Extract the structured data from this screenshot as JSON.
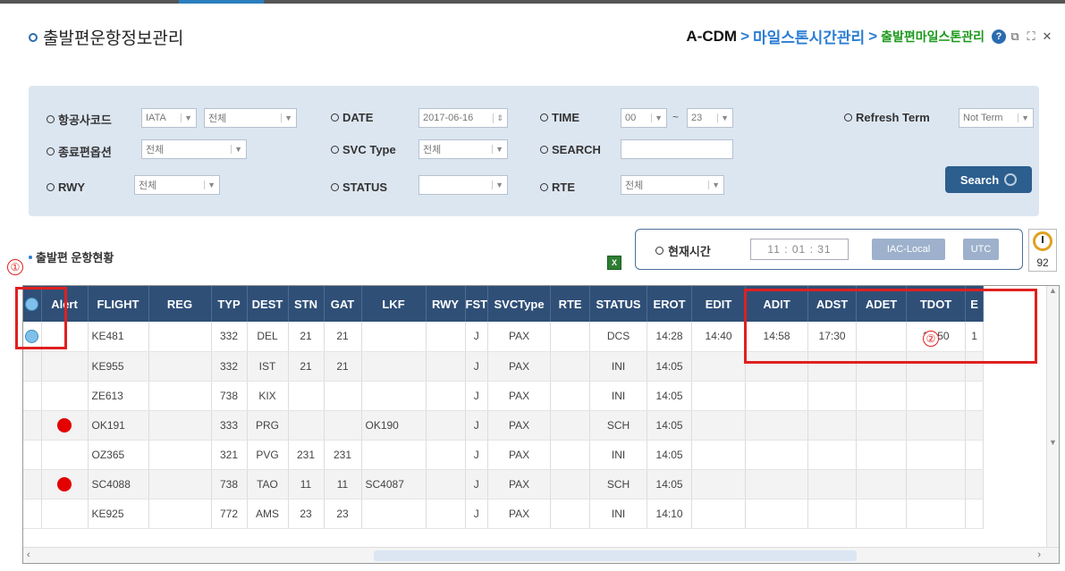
{
  "header": {
    "title": "출발편운항정보관리",
    "breadcrumb": {
      "root": "A-CDM",
      "sep": ">",
      "mid": "마일스톤시간관리",
      "current": "출발편마일스톤관리"
    }
  },
  "filters": {
    "airline": {
      "label": "항공사코드",
      "type_value": "IATA",
      "value": "전체"
    },
    "date": {
      "label": "DATE",
      "value": "2017-06-16"
    },
    "time": {
      "label": "TIME",
      "from": "00",
      "dash": "~",
      "to": "23"
    },
    "refresh": {
      "label": "Refresh Term",
      "value": "Not Term"
    },
    "end_option": {
      "label": "종료편옵션",
      "value": "전체"
    },
    "svc_type": {
      "label": "SVC Type",
      "value": "전체"
    },
    "search": {
      "label": "SEARCH",
      "value": ""
    },
    "rwy": {
      "label": "RWY",
      "value": "전체"
    },
    "status": {
      "label": "STATUS",
      "value": ""
    },
    "rte": {
      "label": "RTE",
      "value": "전체"
    },
    "search_button": "Search"
  },
  "section": {
    "title": "출발편 운항현황"
  },
  "clock": {
    "label": "현재시간",
    "time": "11 : 01 : 31",
    "btn_local": "IAC-Local",
    "btn_utc": "UTC",
    "alarm_count": "92"
  },
  "annotations": {
    "one": "①",
    "two": "②"
  },
  "table": {
    "columns": [
      "",
      "Alert",
      "FLIGHT",
      "REG",
      "TYP",
      "DEST",
      "STN",
      "GAT",
      "LKF",
      "RWY",
      "FST",
      "SVCType",
      "RTE",
      "STATUS",
      "EROT",
      "EDIT",
      "ADIT",
      "ADST",
      "ADET",
      "TDOT",
      "E"
    ],
    "rows": [
      {
        "icon": "globe",
        "alert": "",
        "flight": "KE481",
        "reg": "",
        "typ": "332",
        "dest": "DEL",
        "stn": "21",
        "gat": "21",
        "lkf": "",
        "rwy": "",
        "fst": "J",
        "svc": "PAX",
        "rte": "",
        "status": "DCS",
        "erot": "14:28",
        "edit": "14:40",
        "adit": "14:58",
        "adst": "17:30",
        "adet": "",
        "tdot": "17:50",
        "e": "1"
      },
      {
        "icon": "",
        "alert": "",
        "flight": "KE955",
        "reg": "",
        "typ": "332",
        "dest": "IST",
        "stn": "21",
        "gat": "21",
        "lkf": "",
        "rwy": "",
        "fst": "J",
        "svc": "PAX",
        "rte": "",
        "status": "INI",
        "erot": "14:05",
        "edit": "",
        "adit": "",
        "adst": "",
        "adet": "",
        "tdot": "",
        "e": ""
      },
      {
        "icon": "",
        "alert": "",
        "flight": "ZE613",
        "reg": "",
        "typ": "738",
        "dest": "KIX",
        "stn": "",
        "gat": "",
        "lkf": "",
        "rwy": "",
        "fst": "J",
        "svc": "PAX",
        "rte": "",
        "status": "INI",
        "erot": "14:05",
        "edit": "",
        "adit": "",
        "adst": "",
        "adet": "",
        "tdot": "",
        "e": ""
      },
      {
        "icon": "",
        "alert": "red",
        "flight": "OK191",
        "reg": "",
        "typ": "333",
        "dest": "PRG",
        "stn": "",
        "gat": "",
        "lkf": "OK190",
        "rwy": "",
        "fst": "J",
        "svc": "PAX",
        "rte": "",
        "status": "SCH",
        "erot": "14:05",
        "edit": "",
        "adit": "",
        "adst": "",
        "adet": "",
        "tdot": "",
        "e": ""
      },
      {
        "icon": "",
        "alert": "",
        "flight": "OZ365",
        "reg": "",
        "typ": "321",
        "dest": "PVG",
        "stn": "231",
        "gat": "231",
        "lkf": "",
        "rwy": "",
        "fst": "J",
        "svc": "PAX",
        "rte": "",
        "status": "INI",
        "erot": "14:05",
        "edit": "",
        "adit": "",
        "adst": "",
        "adet": "",
        "tdot": "",
        "e": ""
      },
      {
        "icon": "",
        "alert": "red",
        "flight": "SC4088",
        "reg": "",
        "typ": "738",
        "dest": "TAO",
        "stn": "11",
        "gat": "11",
        "lkf": "SC4087",
        "rwy": "",
        "fst": "J",
        "svc": "PAX",
        "rte": "",
        "status": "SCH",
        "erot": "14:05",
        "edit": "",
        "adit": "",
        "adst": "",
        "adet": "",
        "tdot": "",
        "e": ""
      },
      {
        "icon": "",
        "alert": "",
        "flight": "KE925",
        "reg": "",
        "typ": "772",
        "dest": "AMS",
        "stn": "23",
        "gat": "23",
        "lkf": "",
        "rwy": "",
        "fst": "J",
        "svc": "PAX",
        "rte": "",
        "status": "INI",
        "erot": "14:10",
        "edit": "",
        "adit": "",
        "adst": "",
        "adet": "",
        "tdot": "",
        "e": ""
      }
    ]
  },
  "colors": {
    "header_bg": "#2f4f77",
    "filter_bg": "#dce6f1",
    "accent_blue": "#2b7dd4",
    "accent_green": "#1a9a1a",
    "annotation_red": "#e02020",
    "alert_red": "#e30000"
  }
}
